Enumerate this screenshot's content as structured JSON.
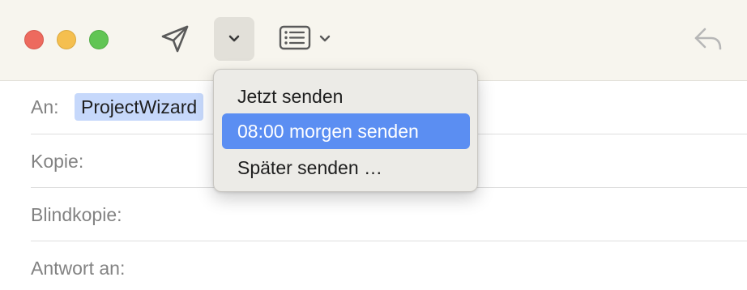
{
  "toolbar": {
    "window_controls": [
      {
        "name": "close",
        "color": "#ed6a5e"
      },
      {
        "name": "minimize",
        "color": "#f5bf4f"
      },
      {
        "name": "zoom",
        "color": "#61c554"
      }
    ],
    "icons": {
      "send": "paper-plane-icon",
      "send_menu": "chevron-down-icon",
      "format": "format-bar-icon",
      "reply": "reply-arrow-icon"
    }
  },
  "fields": {
    "to_label": "An:",
    "to_recipient": "ProjectWizard",
    "cc_label": "Kopie:",
    "bcc_label": "Blindkopie:",
    "reply_to_label": "Antwort an:"
  },
  "send_menu": {
    "items": [
      {
        "label": "Jetzt senden",
        "selected": false
      },
      {
        "label": "08:00 morgen senden",
        "selected": true
      },
      {
        "label": "Später senden …",
        "selected": false
      }
    ],
    "accent": "#5b8ef2"
  }
}
